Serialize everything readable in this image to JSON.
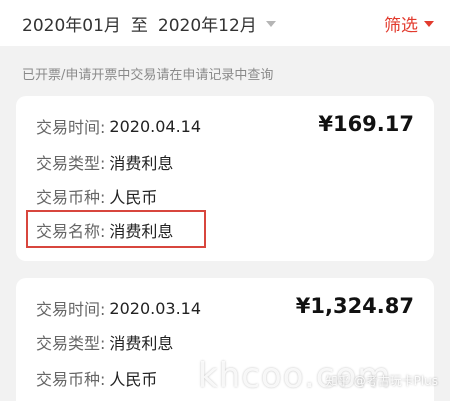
{
  "filter_bar": {
    "start": "2020年01月",
    "to": "至",
    "end": "2020年12月",
    "filter_label": "筛选"
  },
  "notice": "已开票/申请开票中交易请在申请记录中查询",
  "labels": {
    "time": "交易时间:",
    "type": "交易类型:",
    "currency": "交易币种:",
    "name": "交易名称:"
  },
  "transactions": [
    {
      "time": "2020.04.14",
      "amount": "¥169.17",
      "type": "消费利息",
      "currency": "人民币",
      "name": "消费利息"
    },
    {
      "time": "2020.03.14",
      "amount": "¥1,324.87",
      "type": "消费利息",
      "currency": "人民币"
    }
  ],
  "watermark": "khcoo.com",
  "credit": "知乎 @考古玩卡Plus",
  "colors": {
    "accent": "#e23b2e",
    "highlight_box": "#d8463d",
    "background": "#f2f2f2"
  }
}
